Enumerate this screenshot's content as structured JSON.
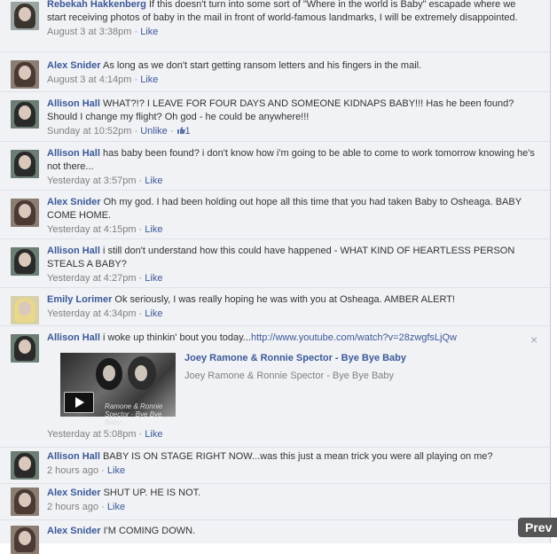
{
  "comments": [
    {
      "author": "Rebekah Hakkenberg",
      "text": "If this doesn't turn into some sort of \"Where in the world is Baby\" escapade where we start receiving photos of baby in the mail in front of world-famous landmarks, I will be extremely disappointed.",
      "time": "August 3 at 3:38pm",
      "sep": " · ",
      "action": "Like"
    },
    {
      "author": "Alex Snider",
      "text": "As long as we don't start getting ransom letters and his fingers in the mail.",
      "time": "August 3 at 4:14pm",
      "sep": " · ",
      "action": "Like"
    },
    {
      "author": "Allison Hall",
      "text": "WHAT?!? I LEAVE FOR FOUR DAYS AND SOMEONE KIDNAPS BABY!!! Has he been found? Should I change my flight? Oh god - he could be anywhere!!!",
      "time": "Sunday at 10:52pm",
      "sep": " · ",
      "action": "Unlike",
      "sep2": " · ",
      "like_count": "1"
    },
    {
      "author": "Allison Hall",
      "text": "has baby been found? i don't know how i'm going to be able to come to work tomorrow knowing he's not there...",
      "time": "Yesterday at 3:57pm",
      "sep": " · ",
      "action": "Like"
    },
    {
      "author": "Alex Snider",
      "text": "Oh my god. I had been holding out hope all this time that you had taken Baby to Osheaga. BABY COME HOME.",
      "time": "Yesterday at 4:15pm",
      "sep": " · ",
      "action": "Like"
    },
    {
      "author": "Allison Hall",
      "text": "i still don't understand how this could have happened - WHAT KIND OF HEARTLESS PERSON STEALS A BABY?",
      "time": "Yesterday at 4:27pm",
      "sep": " · ",
      "action": "Like"
    },
    {
      "author": "Emily Lorimer",
      "text": "Ok seriously, I was really hoping he was with you at Osheaga. AMBER ALERT!",
      "time": "Yesterday at 4:34pm",
      "sep": " · ",
      "action": "Like"
    },
    {
      "author": "Allison Hall",
      "text": "i woke up thinkin' bout you today...",
      "url": "http://www.youtube.com/watch?v=28zwgfsLjQw",
      "time": "Yesterday at 5:08pm",
      "sep": " · ",
      "action": "Like",
      "attachment": {
        "title": "Joey Ramone & Ronnie Spector - Bye Bye Baby",
        "subtitle": "Joey Ramone & Ronnie Spector - Bye Bye Baby",
        "thumb_caption": "Ramone & Ronnie Spector · Bye Bye Baby"
      }
    },
    {
      "author": "Allison Hall",
      "text": "BABY IS ON STAGE RIGHT NOW...was this just a mean trick you were all playing on me?",
      "time": "2 hours ago",
      "sep": " · ",
      "action": "Like"
    },
    {
      "author": "Alex Snider",
      "text": "SHUT UP. HE IS NOT.",
      "time": "2 hours ago",
      "sep": " · ",
      "action": "Like"
    },
    {
      "author": "Alex Snider",
      "text": "I'M COMING DOWN."
    }
  ],
  "close_glyph": "×",
  "prev_label": "Prev",
  "colors": {
    "link": "#3b5998",
    "text": "#333333",
    "meta": "#808080",
    "background": "#f1f2f5"
  }
}
